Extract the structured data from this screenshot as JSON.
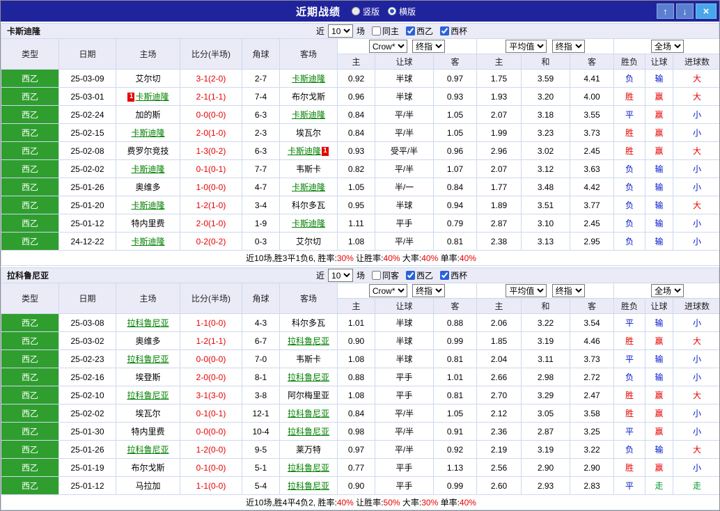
{
  "topbar": {
    "title": "近期战绩",
    "vertical_label": "竖版",
    "horizontal_label": "横版",
    "vertical_selected": false,
    "horizontal_selected": true,
    "up_icon": "↑",
    "down_icon": "↓",
    "close_icon": "×"
  },
  "colors": {
    "topbar_bg": "#20249c",
    "header_bg": "#ebebf8",
    "league_green": "#2f9e2f",
    "win_red": "#e60000",
    "lose_blue": "#0016cc",
    "push_green": "#009933",
    "team_link_green": "#008000"
  },
  "headers": {
    "type": "类型",
    "date": "日期",
    "home": "主场",
    "score": "比分(半场)",
    "corner": "角球",
    "away": "客场",
    "odds_home": "主",
    "odds_handicap": "让球",
    "odds_away": "客",
    "avg_home": "主",
    "avg_draw": "和",
    "avg_away": "客",
    "result": "胜负",
    "handicap_result": "让球",
    "goals": "进球数"
  },
  "sections": [
    {
      "team": "卡斯迪隆",
      "filters": {
        "near_label": "近",
        "count": "10",
        "games_label": "场",
        "same_label": "同主",
        "same_checked": false,
        "league_label": "西乙",
        "league_checked": true,
        "cup_label": "西杯",
        "cup_checked": true
      },
      "selects": {
        "bookmaker": "Crow*",
        "stage1": "终指",
        "average": "平均值",
        "stage2": "终指",
        "scope": "全场"
      },
      "rows": [
        {
          "league": "西乙",
          "date": "25-03-09",
          "home": "艾尔切",
          "home_green": false,
          "home_card": "",
          "score": "3-1(2-0)",
          "corner": "2-7",
          "away": "卡斯迪隆",
          "away_green": true,
          "away_card": "",
          "odds": [
            "0.92",
            "半球",
            "0.97"
          ],
          "avg": [
            "1.75",
            "3.59",
            "4.41"
          ],
          "result": "负",
          "let_result": "输",
          "goals": "大"
        },
        {
          "league": "西乙",
          "date": "25-03-01",
          "home": "卡斯迪隆",
          "home_green": true,
          "home_card": "1",
          "score": "2-1(1-1)",
          "corner": "7-4",
          "away": "布尔戈斯",
          "away_green": false,
          "away_card": "",
          "odds": [
            "0.96",
            "半球",
            "0.93"
          ],
          "avg": [
            "1.93",
            "3.20",
            "4.00"
          ],
          "result": "胜",
          "let_result": "赢",
          "goals": "大"
        },
        {
          "league": "西乙",
          "date": "25-02-24",
          "home": "加的斯",
          "home_green": false,
          "home_card": "",
          "score": "0-0(0-0)",
          "corner": "6-3",
          "away": "卡斯迪隆",
          "away_green": true,
          "away_card": "",
          "odds": [
            "0.84",
            "平/半",
            "1.05"
          ],
          "avg": [
            "2.07",
            "3.18",
            "3.55"
          ],
          "result": "平",
          "let_result": "赢",
          "goals": "小"
        },
        {
          "league": "西乙",
          "date": "25-02-15",
          "home": "卡斯迪隆",
          "home_green": true,
          "home_card": "",
          "score": "2-0(1-0)",
          "corner": "2-3",
          "away": "埃瓦尔",
          "away_green": false,
          "away_card": "",
          "odds": [
            "0.84",
            "平/半",
            "1.05"
          ],
          "avg": [
            "1.99",
            "3.23",
            "3.73"
          ],
          "result": "胜",
          "let_result": "赢",
          "goals": "小"
        },
        {
          "league": "西乙",
          "date": "25-02-08",
          "home": "费罗尔竞技",
          "home_green": false,
          "home_card": "",
          "score": "1-3(0-2)",
          "corner": "6-3",
          "away": "卡斯迪隆",
          "away_green": true,
          "away_card": "1",
          "odds": [
            "0.93",
            "受平/半",
            "0.96"
          ],
          "avg": [
            "2.96",
            "3.02",
            "2.45"
          ],
          "result": "胜",
          "let_result": "赢",
          "goals": "大"
        },
        {
          "league": "西乙",
          "date": "25-02-02",
          "home": "卡斯迪隆",
          "home_green": true,
          "home_card": "",
          "score": "0-1(0-1)",
          "corner": "7-7",
          "away": "韦斯卡",
          "away_green": false,
          "away_card": "",
          "odds": [
            "0.82",
            "平/半",
            "1.07"
          ],
          "avg": [
            "2.07",
            "3.12",
            "3.63"
          ],
          "result": "负",
          "let_result": "输",
          "goals": "小"
        },
        {
          "league": "西乙",
          "date": "25-01-26",
          "home": "奥维多",
          "home_green": false,
          "home_card": "",
          "score": "1-0(0-0)",
          "corner": "4-7",
          "away": "卡斯迪隆",
          "away_green": true,
          "away_card": "",
          "odds": [
            "1.05",
            "半/一",
            "0.84"
          ],
          "avg": [
            "1.77",
            "3.48",
            "4.42"
          ],
          "result": "负",
          "let_result": "输",
          "goals": "小"
        },
        {
          "league": "西乙",
          "date": "25-01-20",
          "home": "卡斯迪隆",
          "home_green": true,
          "home_card": "",
          "score": "1-2(1-0)",
          "corner": "3-4",
          "away": "科尔多瓦",
          "away_green": false,
          "away_card": "",
          "odds": [
            "0.95",
            "半球",
            "0.94"
          ],
          "avg": [
            "1.89",
            "3.51",
            "3.77"
          ],
          "result": "负",
          "let_result": "输",
          "goals": "大"
        },
        {
          "league": "西乙",
          "date": "25-01-12",
          "home": "特内里费",
          "home_green": false,
          "home_card": "",
          "score": "2-0(1-0)",
          "corner": "1-9",
          "away": "卡斯迪隆",
          "away_green": true,
          "away_card": "",
          "odds": [
            "1.11",
            "平手",
            "0.79"
          ],
          "avg": [
            "2.87",
            "3.10",
            "2.45"
          ],
          "result": "负",
          "let_result": "输",
          "goals": "小"
        },
        {
          "league": "西乙",
          "date": "24-12-22",
          "home": "卡斯迪隆",
          "home_green": true,
          "home_card": "",
          "score": "0-2(0-2)",
          "corner": "0-3",
          "away": "艾尔切",
          "away_green": false,
          "away_card": "",
          "odds": [
            "1.08",
            "平/半",
            "0.81"
          ],
          "avg": [
            "2.38",
            "3.13",
            "2.95"
          ],
          "result": "负",
          "let_result": "输",
          "goals": "小"
        }
      ],
      "summary": {
        "prefix": "近10场,胜3平1负6,",
        "items": [
          {
            "label": "胜率:",
            "value": "30%"
          },
          {
            "label": "让胜率:",
            "value": "40%"
          },
          {
            "label": "大率:",
            "value": "40%"
          },
          {
            "label": "单率:",
            "value": "40%"
          }
        ]
      }
    },
    {
      "team": "拉科鲁尼亚",
      "filters": {
        "near_label": "近",
        "count": "10",
        "games_label": "场",
        "same_label": "同客",
        "same_checked": false,
        "league_label": "西乙",
        "league_checked": true,
        "cup_label": "西杯",
        "cup_checked": true
      },
      "selects": {
        "bookmaker": "Crow*",
        "stage1": "终指",
        "average": "平均值",
        "stage2": "终指",
        "scope": "全场"
      },
      "rows": [
        {
          "league": "西乙",
          "date": "25-03-08",
          "home": "拉科鲁尼亚",
          "home_green": true,
          "home_card": "",
          "score": "1-1(0-0)",
          "corner": "4-3",
          "away": "科尔多瓦",
          "away_green": false,
          "away_card": "",
          "odds": [
            "1.01",
            "半球",
            "0.88"
          ],
          "avg": [
            "2.06",
            "3.22",
            "3.54"
          ],
          "result": "平",
          "let_result": "输",
          "goals": "小"
        },
        {
          "league": "西乙",
          "date": "25-03-02",
          "home": "奥维多",
          "home_green": false,
          "home_card": "",
          "score": "1-2(1-1)",
          "corner": "6-7",
          "away": "拉科鲁尼亚",
          "away_green": true,
          "away_card": "",
          "odds": [
            "0.90",
            "半球",
            "0.99"
          ],
          "avg": [
            "1.85",
            "3.19",
            "4.46"
          ],
          "result": "胜",
          "let_result": "赢",
          "goals": "大"
        },
        {
          "league": "西乙",
          "date": "25-02-23",
          "home": "拉科鲁尼亚",
          "home_green": true,
          "home_card": "",
          "score": "0-0(0-0)",
          "corner": "7-0",
          "away": "韦斯卡",
          "away_green": false,
          "away_card": "",
          "odds": [
            "1.08",
            "半球",
            "0.81"
          ],
          "avg": [
            "2.04",
            "3.11",
            "3.73"
          ],
          "result": "平",
          "let_result": "输",
          "goals": "小"
        },
        {
          "league": "西乙",
          "date": "25-02-16",
          "home": "埃登斯",
          "home_green": false,
          "home_card": "",
          "score": "2-0(0-0)",
          "corner": "8-1",
          "away": "拉科鲁尼亚",
          "away_green": true,
          "away_card": "",
          "odds": [
            "0.88",
            "平手",
            "1.01"
          ],
          "avg": [
            "2.66",
            "2.98",
            "2.72"
          ],
          "result": "负",
          "let_result": "输",
          "goals": "小"
        },
        {
          "league": "西乙",
          "date": "25-02-10",
          "home": "拉科鲁尼亚",
          "home_green": true,
          "home_card": "",
          "score": "3-1(3-0)",
          "corner": "3-8",
          "away": "阿尔梅里亚",
          "away_green": false,
          "away_card": "",
          "odds": [
            "1.08",
            "平手",
            "0.81"
          ],
          "avg": [
            "2.70",
            "3.29",
            "2.47"
          ],
          "result": "胜",
          "let_result": "赢",
          "goals": "大"
        },
        {
          "league": "西乙",
          "date": "25-02-02",
          "home": "埃瓦尔",
          "home_green": false,
          "home_card": "",
          "score": "0-1(0-1)",
          "corner": "12-1",
          "away": "拉科鲁尼亚",
          "away_green": true,
          "away_card": "",
          "odds": [
            "0.84",
            "平/半",
            "1.05"
          ],
          "avg": [
            "2.12",
            "3.05",
            "3.58"
          ],
          "result": "胜",
          "let_result": "赢",
          "goals": "小"
        },
        {
          "league": "西乙",
          "date": "25-01-30",
          "home": "特内里费",
          "home_green": false,
          "home_card": "",
          "score": "0-0(0-0)",
          "corner": "10-4",
          "away": "拉科鲁尼亚",
          "away_green": true,
          "away_card": "",
          "odds": [
            "0.98",
            "平/半",
            "0.91"
          ],
          "avg": [
            "2.36",
            "2.87",
            "3.25"
          ],
          "result": "平",
          "let_result": "赢",
          "goals": "小"
        },
        {
          "league": "西乙",
          "date": "25-01-26",
          "home": "拉科鲁尼亚",
          "home_green": true,
          "home_card": "",
          "score": "1-2(0-0)",
          "corner": "9-5",
          "away": "莱万特",
          "away_green": false,
          "away_card": "",
          "odds": [
            "0.97",
            "平/半",
            "0.92"
          ],
          "avg": [
            "2.19",
            "3.19",
            "3.22"
          ],
          "result": "负",
          "let_result": "输",
          "goals": "大"
        },
        {
          "league": "西乙",
          "date": "25-01-19",
          "home": "布尔戈斯",
          "home_green": false,
          "home_card": "",
          "score": "0-1(0-0)",
          "corner": "5-1",
          "away": "拉科鲁尼亚",
          "away_green": true,
          "away_card": "",
          "odds": [
            "0.77",
            "平手",
            "1.13"
          ],
          "avg": [
            "2.56",
            "2.90",
            "2.90"
          ],
          "result": "胜",
          "let_result": "赢",
          "goals": "小"
        },
        {
          "league": "西乙",
          "date": "25-01-12",
          "home": "马拉加",
          "home_green": false,
          "home_card": "",
          "score": "1-1(0-0)",
          "corner": "5-4",
          "away": "拉科鲁尼亚",
          "away_green": true,
          "away_card": "",
          "odds": [
            "0.90",
            "平手",
            "0.99"
          ],
          "avg": [
            "2.60",
            "2.93",
            "2.83"
          ],
          "result": "平",
          "let_result": "走",
          "goals": "走"
        }
      ],
      "summary": {
        "prefix": "近10场,胜4平4负2,",
        "items": [
          {
            "label": "胜率:",
            "value": "40%"
          },
          {
            "label": "让胜率:",
            "value": "50%"
          },
          {
            "label": "大率:",
            "value": "30%"
          },
          {
            "label": "单率:",
            "value": "40%"
          }
        ]
      }
    }
  ]
}
